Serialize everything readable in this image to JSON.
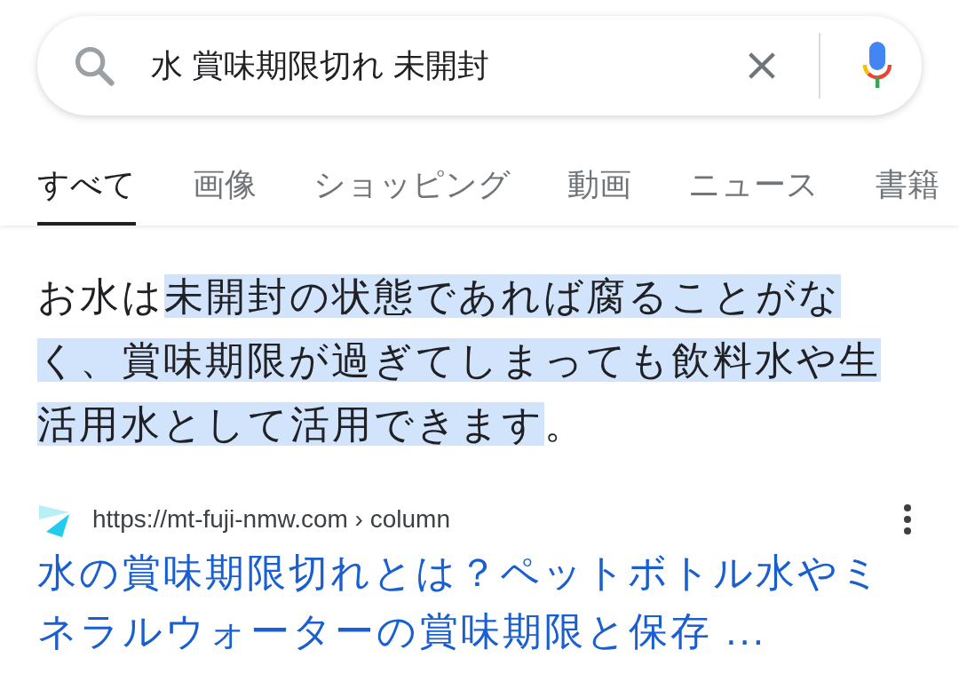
{
  "search": {
    "value": "水 賞味期限切れ 未開封"
  },
  "tabs": [
    {
      "label": "すべて",
      "selected": true
    },
    {
      "label": "画像",
      "selected": false
    },
    {
      "label": "ショッピング",
      "selected": false
    },
    {
      "label": "動画",
      "selected": false
    },
    {
      "label": "ニュース",
      "selected": false
    },
    {
      "label": "書籍",
      "selected": false
    }
  ],
  "snippet": [
    {
      "text": "お水は",
      "highlighted": false
    },
    {
      "text": "未開封の状態であれば腐ることがなく、賞味期限が過ぎてしまっても飲料水や生活用水として活用できます",
      "highlighted": true
    },
    {
      "text": "。",
      "highlighted": false
    }
  ],
  "result": {
    "url": "https://mt-fuji-nmw.com › column",
    "title": "水の賞味期限切れとは？ペットボトル水やミネラルウォーターの賞味期限と保存 ..."
  }
}
